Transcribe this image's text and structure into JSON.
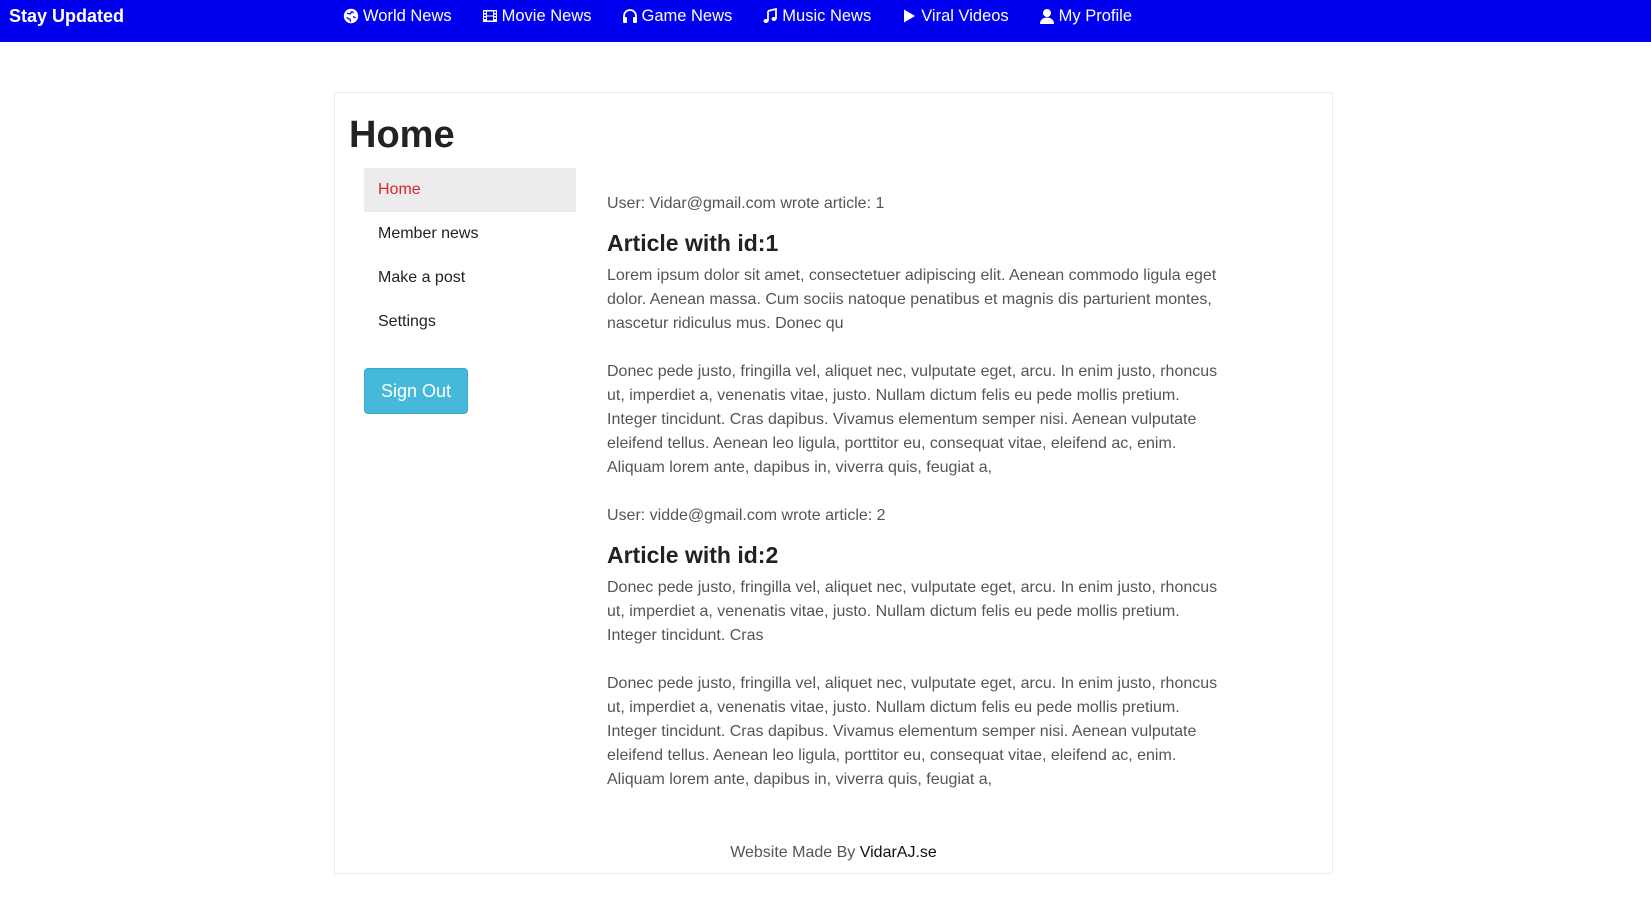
{
  "topbar": {
    "brand": "Stay Updated",
    "nav": [
      {
        "label": "World News",
        "icon": "globe-icon"
      },
      {
        "label": "Movie News",
        "icon": "film-icon"
      },
      {
        "label": "Game News",
        "icon": "headphones-icon"
      },
      {
        "label": "Music News",
        "icon": "music-note-icon"
      },
      {
        "label": "Viral Videos",
        "icon": "play-icon"
      },
      {
        "label": "My Profile",
        "icon": "user-icon"
      }
    ],
    "background_color": "#0000ee"
  },
  "page": {
    "title": "Home"
  },
  "sidebar": {
    "items": [
      {
        "label": "Home",
        "active": true
      },
      {
        "label": "Member news"
      },
      {
        "label": "Make a post"
      },
      {
        "label": "Settings"
      }
    ],
    "active_color": "#d9232d",
    "sign_out_label": "Sign Out",
    "sign_out_color": "#46b8da"
  },
  "articles": [
    {
      "meta": "User: Vidar@gmail.com wrote article: 1",
      "title": "Article with id:1",
      "paragraphs": [
        "Lorem ipsum dolor sit amet, consectetuer adipiscing elit. Aenean commodo ligula eget dolor. Aenean massa. Cum sociis natoque penatibus et magnis dis parturient montes, nascetur ridiculus mus. Donec qu",
        "Donec pede justo, fringilla vel, aliquet nec, vulputate eget, arcu. In enim justo, rhoncus ut, imperdiet a, venenatis vitae, justo. Nullam dictum felis eu pede mollis pretium. Integer tincidunt. Cras dapibus. Vivamus elementum semper nisi. Aenean vulputate eleifend tellus. Aenean leo ligula, porttitor eu, consequat vitae, eleifend ac, enim. Aliquam lorem ante, dapibus in, viverra quis, feugiat a,"
      ]
    },
    {
      "meta": "User: vidde@gmail.com wrote article: 2",
      "title": "Article with id:2",
      "paragraphs": [
        "Donec pede justo, fringilla vel, aliquet nec, vulputate eget, arcu. In enim justo, rhoncus ut, imperdiet a, venenatis vitae, justo. Nullam dictum felis eu pede mollis pretium. Integer tincidunt. Cras",
        "Donec pede justo, fringilla vel, aliquet nec, vulputate eget, arcu. In enim justo, rhoncus ut, imperdiet a, venenatis vitae, justo. Nullam dictum felis eu pede mollis pretium. Integer tincidunt. Cras dapibus. Vivamus elementum semper nisi. Aenean vulputate eleifend tellus. Aenean leo ligula, porttitor eu, consequat vitae, eleifend ac, enim. Aliquam lorem ante, dapibus in, viverra quis, feugiat a,"
      ]
    }
  ],
  "footer": {
    "text": "Website Made By",
    "link": "VidarAJ.se"
  }
}
